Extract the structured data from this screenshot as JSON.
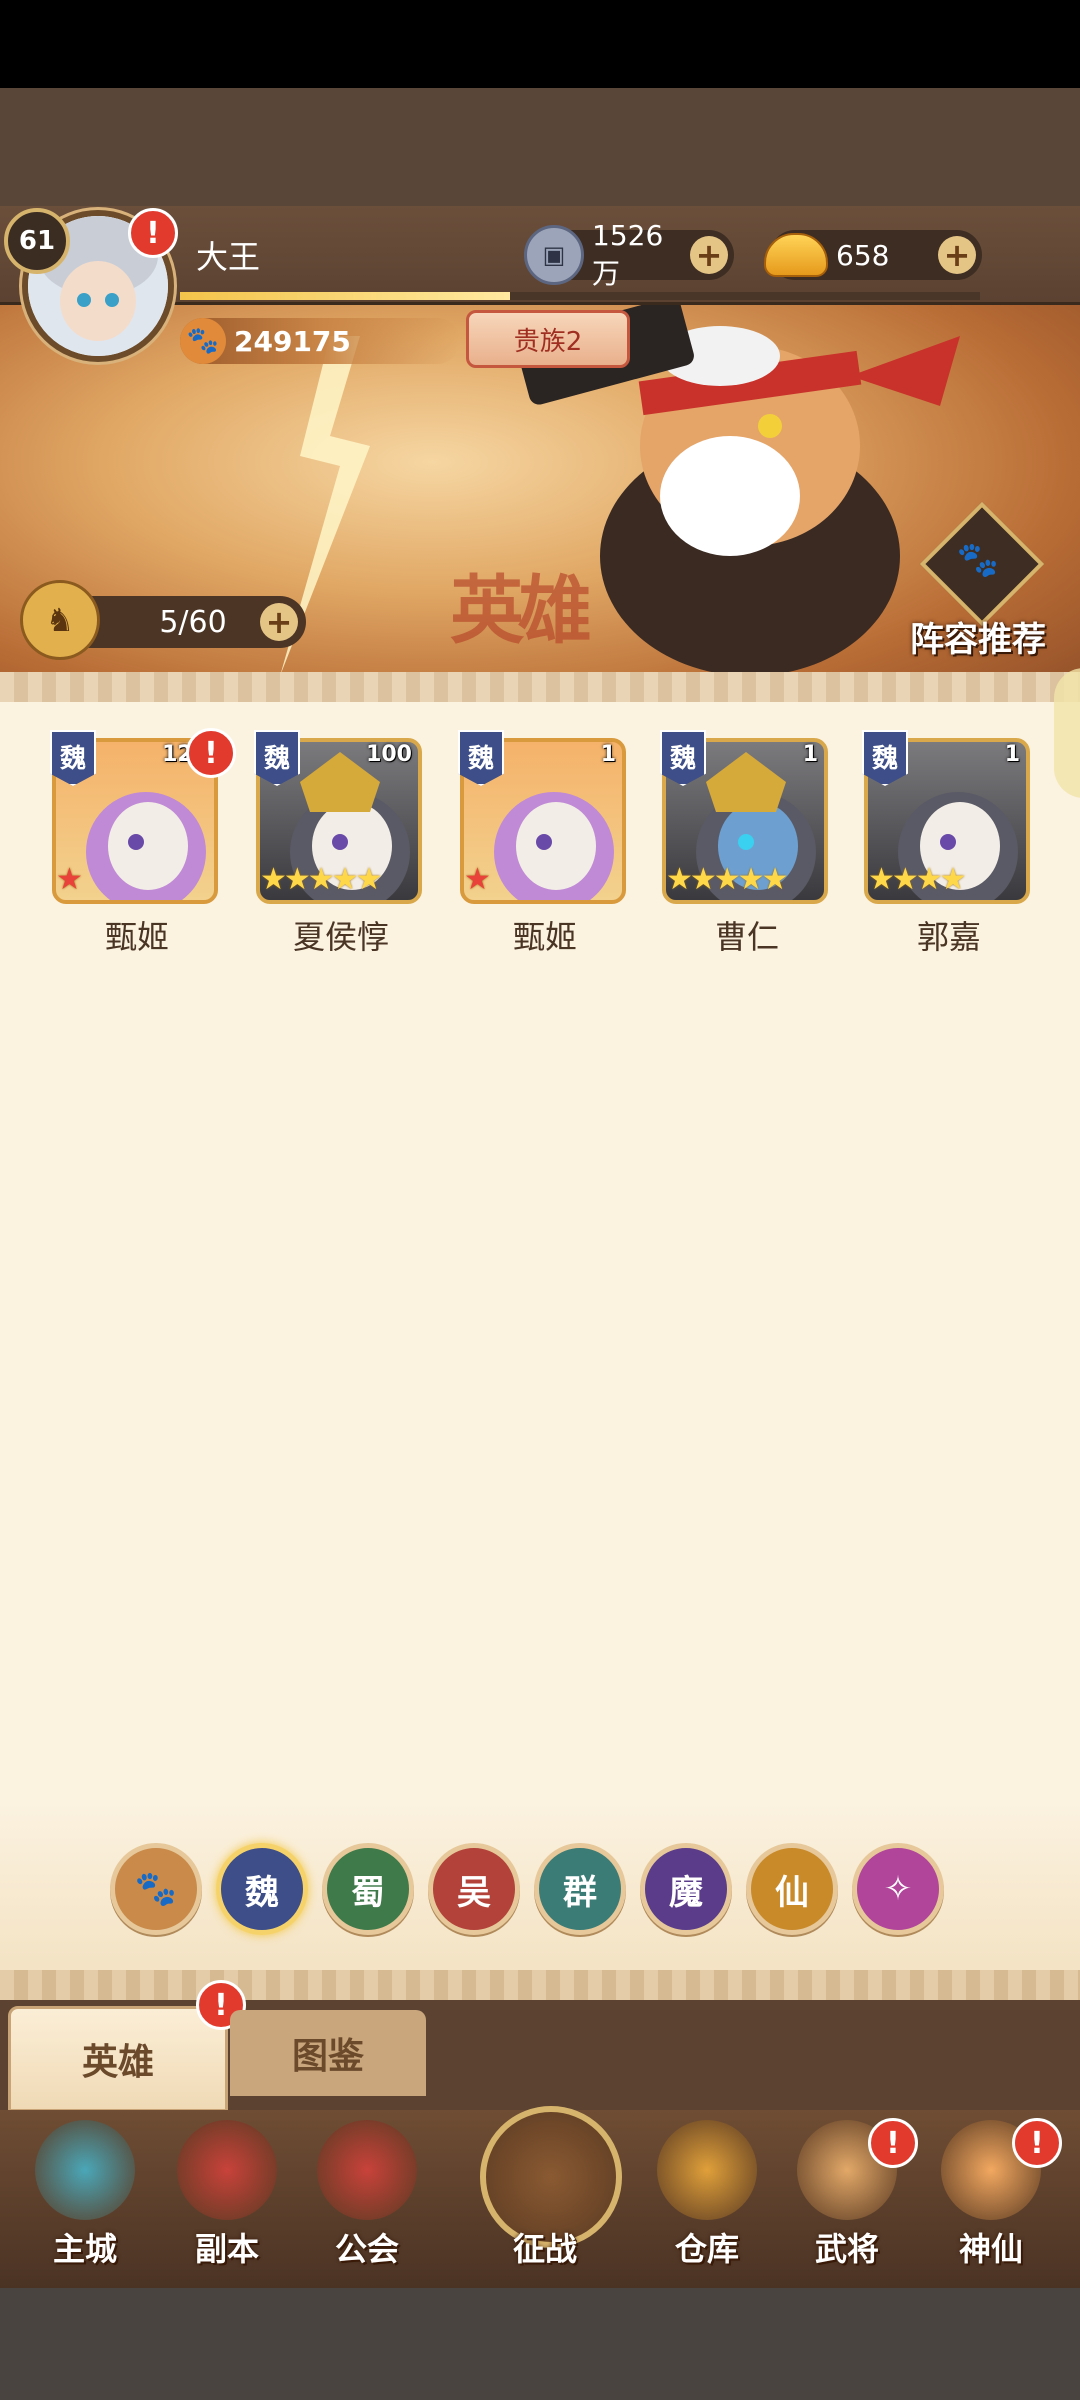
{
  "header": {
    "level": "61",
    "player_name": "大王",
    "power": "249175",
    "noble": "贵族2",
    "currency_coins": "1526万",
    "currency_ingots": "658",
    "alert": "!"
  },
  "banner": {
    "slots": "5/60",
    "title_art": "英雄",
    "recommend_label": "阵容推荐"
  },
  "heroes": [
    {
      "name": "甄姬",
      "faction": "魏",
      "level": "124",
      "stars": "★",
      "star_color": "#e8423a",
      "has_alert": true
    },
    {
      "name": "夏侯惇",
      "faction": "魏",
      "level": "100",
      "stars": "★★★★★",
      "star_color": "#ffd84a",
      "has_alert": false
    },
    {
      "name": "甄姬",
      "faction": "魏",
      "level": "1",
      "stars": "★",
      "star_color": "#e8423a",
      "has_alert": false
    },
    {
      "name": "曹仁",
      "faction": "魏",
      "level": "1",
      "stars": "★★★★★",
      "star_color": "#ffd84a",
      "has_alert": false
    },
    {
      "name": "郭嘉",
      "faction": "魏",
      "level": "1",
      "stars": "★★★★",
      "star_color": "#ffd84a",
      "has_alert": false
    }
  ],
  "filters": [
    {
      "label": "🐾",
      "color": "#c98a4a",
      "name": "filter-all"
    },
    {
      "label": "魏",
      "color": "#3d4e88",
      "name": "filter-wei"
    },
    {
      "label": "蜀",
      "color": "#3e7a4a",
      "name": "filter-shu"
    },
    {
      "label": "吴",
      "color": "#b3423a",
      "name": "filter-wu"
    },
    {
      "label": "群",
      "color": "#3c7c76",
      "name": "filter-qun"
    },
    {
      "label": "魔",
      "color": "#5a3c8a",
      "name": "filter-mo"
    },
    {
      "label": "仙",
      "color": "#c98a2a",
      "name": "filter-xian"
    },
    {
      "label": "✧",
      "color": "#b0459a",
      "name": "filter-special"
    }
  ],
  "tabs": {
    "heroes": "英雄",
    "codex": "图鉴"
  },
  "nav": [
    {
      "label": "主城",
      "name": "nav-main-city",
      "has_alert": false
    },
    {
      "label": "副本",
      "name": "nav-dungeon",
      "has_alert": false
    },
    {
      "label": "公会",
      "name": "nav-guild",
      "has_alert": false
    },
    {
      "label": "征战",
      "name": "nav-campaign",
      "has_alert": false
    },
    {
      "label": "仓库",
      "name": "nav-warehouse",
      "has_alert": false
    },
    {
      "label": "武将",
      "name": "nav-generals",
      "has_alert": true
    },
    {
      "label": "神仙",
      "name": "nav-immortals",
      "has_alert": true
    }
  ]
}
